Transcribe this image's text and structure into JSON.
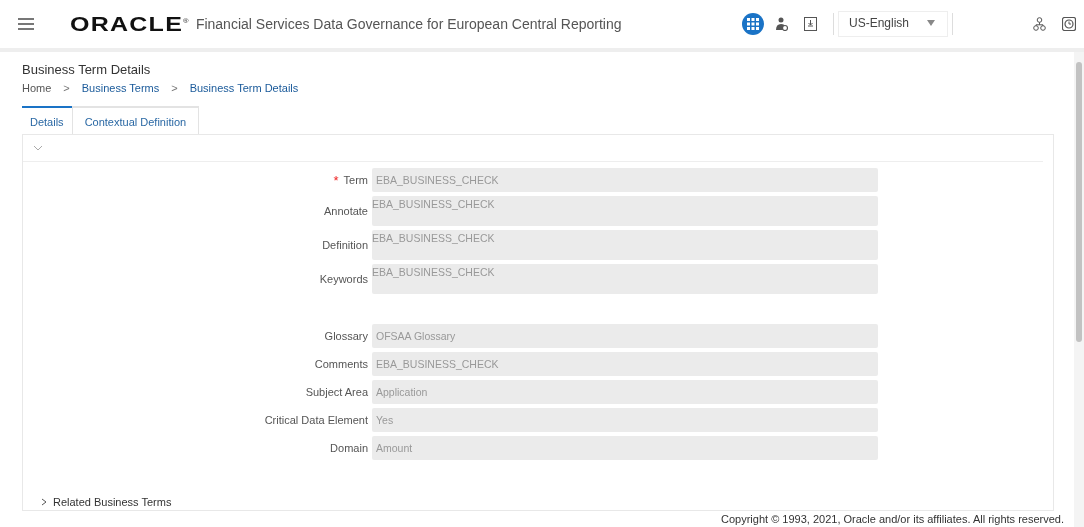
{
  "header": {
    "logo": "ORACLE",
    "logo_mark": "®",
    "title": "Financial Services Data Governance for European Central Reporting",
    "language": "US-English"
  },
  "page": {
    "title": "Business Term Details",
    "breadcrumbs": [
      {
        "label": "Home",
        "link": false
      },
      {
        "label": "Business Terms",
        "link": true
      },
      {
        "label": "Business Term Details",
        "link": true
      }
    ],
    "separator": ">"
  },
  "required_marker": "*",
  "tabs": [
    {
      "label": "Details",
      "selected": true
    },
    {
      "label": "Contextual Definition",
      "selected": false
    }
  ],
  "field_groups": [
    {
      "fields": [
        {
          "label": "Term",
          "value": "EBA_BUSINESS_CHECK",
          "kind": "input",
          "required": true
        },
        {
          "label": "Annotate",
          "value": "EBA_BUSINESS_CHECK",
          "kind": "textarea",
          "required": false
        },
        {
          "label": "Definition",
          "value": "EBA_BUSINESS_CHECK",
          "kind": "textarea",
          "required": false
        },
        {
          "label": "Keywords",
          "value": "EBA_BUSINESS_CHECK",
          "kind": "textarea",
          "required": false
        }
      ]
    },
    {
      "fields": [
        {
          "label": "Glossary",
          "value": "OFSAA Glossary",
          "kind": "input",
          "required": false
        },
        {
          "label": "Comments",
          "value": "EBA_BUSINESS_CHECK",
          "kind": "input",
          "required": false
        },
        {
          "label": "Subject Area",
          "value": "Application",
          "kind": "input",
          "required": false
        },
        {
          "label": "Critical Data Element",
          "value": "Yes",
          "kind": "input",
          "required": false
        },
        {
          "label": "Domain",
          "value": "Amount",
          "kind": "input",
          "required": false
        }
      ]
    }
  ],
  "section": {
    "title": "Related Business Terms",
    "expanded": false
  },
  "footer": "Copyright © 1993, 2021, Oracle and/or its affiliates. All rights reserved."
}
